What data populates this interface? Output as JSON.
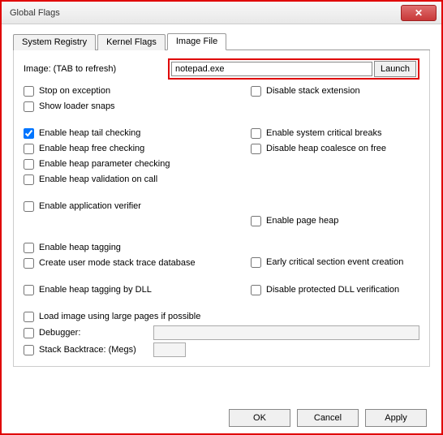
{
  "window": {
    "title": "Global Flags",
    "close_glyph": "✕"
  },
  "tabs": {
    "system_registry": "System Registry",
    "kernel_flags": "Kernel Flags",
    "image_file": "Image File"
  },
  "image_row": {
    "label": "Image: (TAB to refresh)",
    "value": "notepad.exe",
    "launch": "Launch"
  },
  "checks": {
    "stop_on_exception": "Stop on exception",
    "show_loader_snaps": "Show loader snaps",
    "disable_stack_extension": "Disable stack extension",
    "enable_heap_tail": "Enable heap tail checking",
    "enable_heap_free": "Enable heap free checking",
    "enable_heap_param": "Enable heap parameter checking",
    "enable_heap_valid": "Enable heap validation on call",
    "enable_sys_crit": "Enable system critical breaks",
    "disable_heap_coalesce": "Disable heap coalesce on free",
    "enable_app_verifier": "Enable application verifier",
    "enable_page_heap": "Enable page heap",
    "enable_heap_tagging": "Enable heap tagging",
    "create_umst": "Create user mode stack trace database",
    "early_crit": "Early critical section event creation",
    "enable_heap_tag_dll": "Enable heap tagging by DLL",
    "disable_prot_dll": "Disable protected DLL verification",
    "load_large_pages": "Load image using large pages if possible",
    "debugger": "Debugger:",
    "stack_backtrace": "Stack Backtrace: (Megs)"
  },
  "footer": {
    "ok": "OK",
    "cancel": "Cancel",
    "apply": "Apply"
  }
}
